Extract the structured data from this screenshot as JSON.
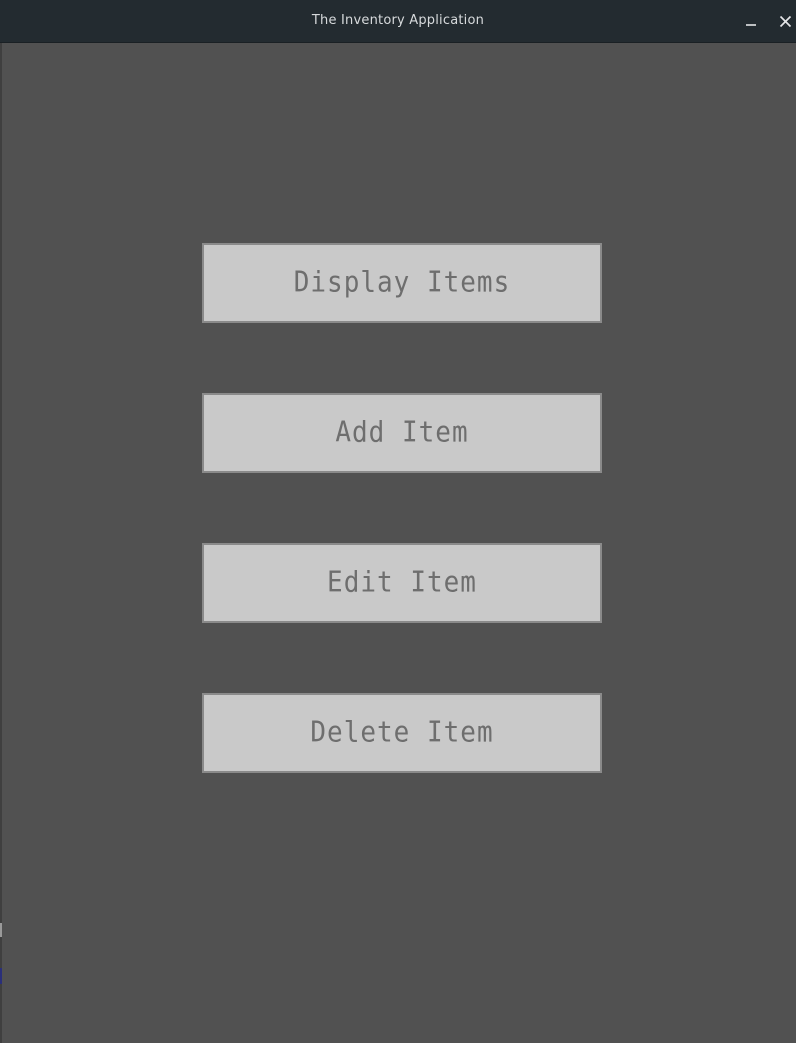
{
  "window": {
    "title": "The Inventory Application",
    "controls": {
      "minimize_icon": "minimize-icon",
      "close_icon": "close-icon"
    }
  },
  "main": {
    "buttons": [
      {
        "label": "Display Items"
      },
      {
        "label": "Add Item"
      },
      {
        "label": "Edit Item"
      },
      {
        "label": "Delete Item"
      }
    ]
  },
  "colors": {
    "titlebar": "#232b30",
    "background": "#515151",
    "button_fill": "#c9c9c9",
    "button_border": "#8a8a8a",
    "button_text": "#6e6e6e"
  }
}
